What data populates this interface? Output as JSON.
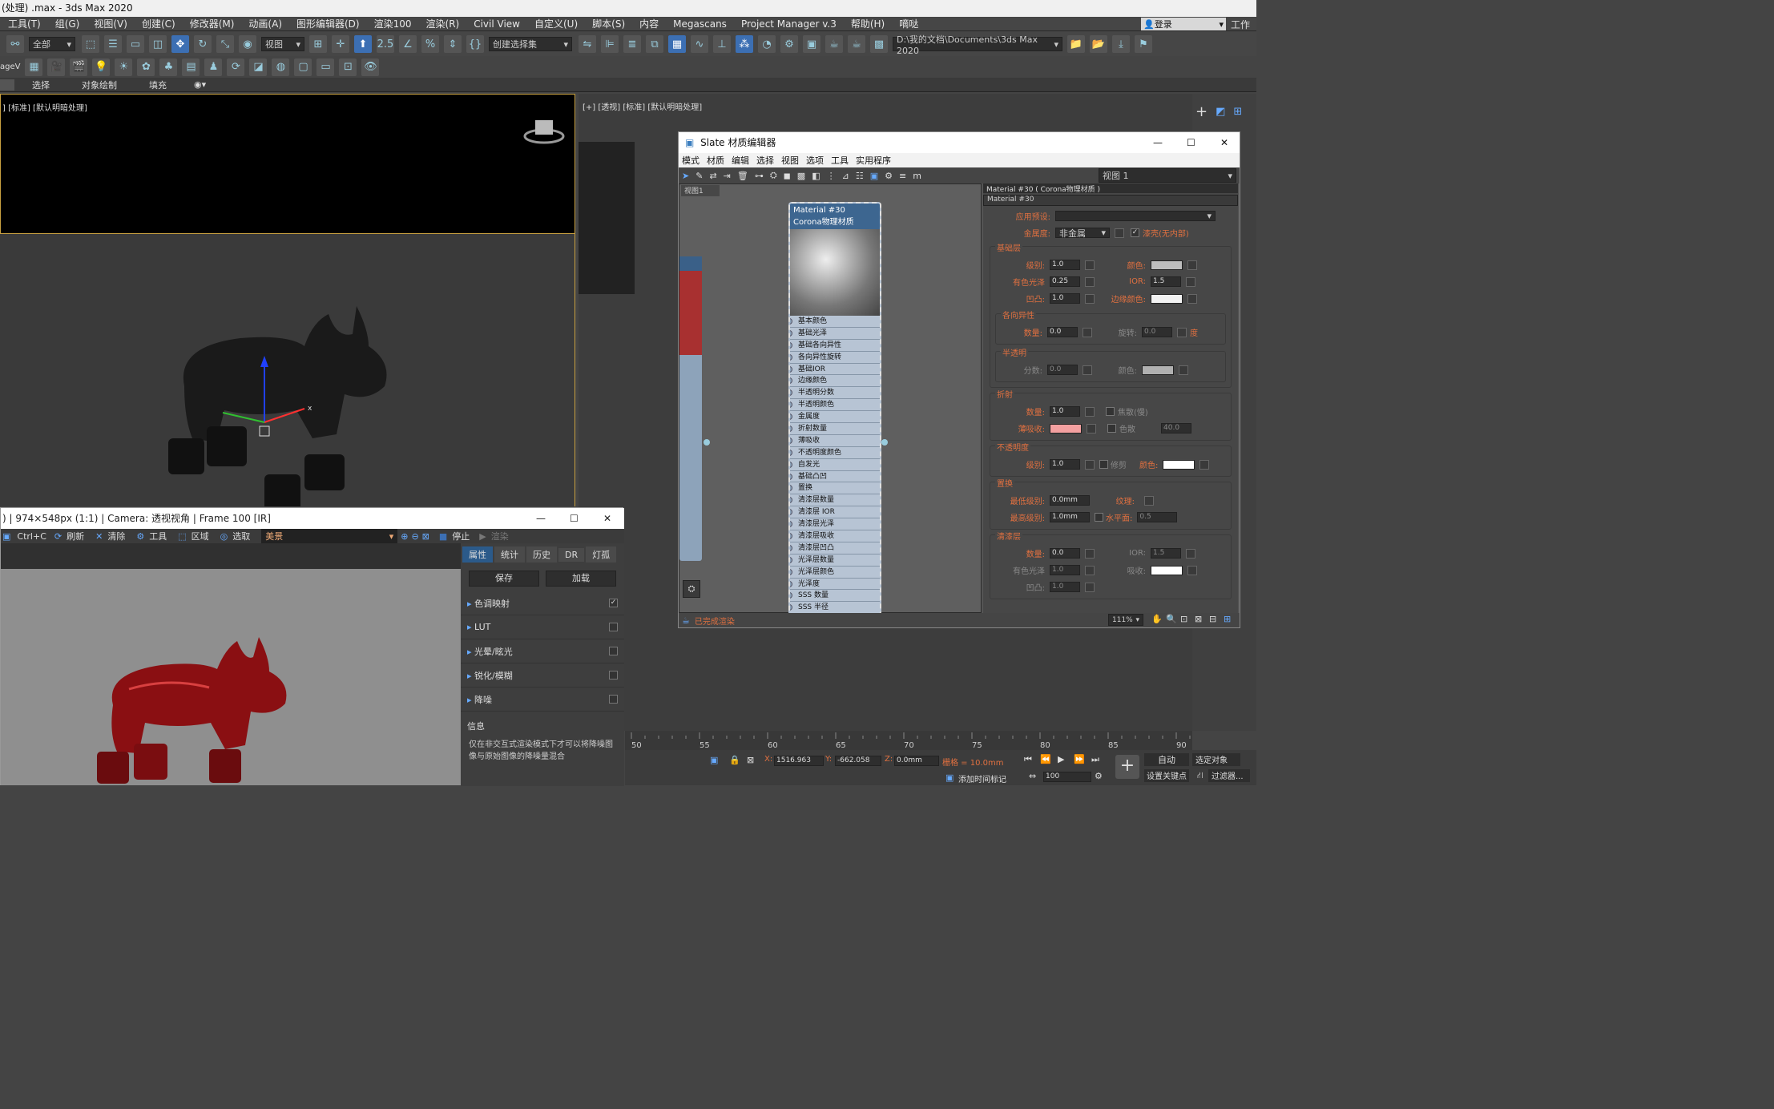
{
  "window": {
    "title": "(处理) .max - 3ds Max 2020"
  },
  "menu": [
    "工具(T)",
    "组(G)",
    "视图(V)",
    "创建(C)",
    "修改器(M)",
    "动画(A)",
    "图形编辑器(D)",
    "渲染100",
    "渲染(R)",
    "Civil View",
    "自定义(U)",
    "脚本(S)",
    "内容",
    "Megascans",
    "Project Manager v.3",
    "帮助(H)",
    "嘀哒"
  ],
  "login": "登录",
  "workspace": "工作区",
  "toolbar": {
    "filter": "全部",
    "refcoord": "视图",
    "selset": "创建选择集",
    "path": "D:\\我的文档\\Documents\\3ds Max 2020"
  },
  "toolbar2": {
    "left": "ageV"
  },
  "ribbon": {
    "items": [
      "选择",
      "对象绘制",
      "填充"
    ]
  },
  "viewports": {
    "top_label": "] [标准] [默认明暗处理]",
    "right_label": "[+] [透视] [标准] [默认明暗处理]"
  },
  "framebuffer": {
    "title": ") | 974×548px (1:1) | Camera: 透视视角 | Frame 100 [IR]",
    "tools": [
      "Ctrl+C",
      "刷新",
      "清除",
      "工具",
      "区域",
      "选取"
    ],
    "preset": "美景",
    "stop": "停止",
    "render": "渲染",
    "tabs": [
      "属性",
      "统计",
      "历史",
      "DR",
      "灯孤"
    ],
    "save": "保存",
    "load": "加载",
    "sections": [
      {
        "label": "色调映射",
        "checked": true
      },
      {
        "label": "LUT",
        "checked": false
      },
      {
        "label": "光晕/眩光",
        "checked": false
      },
      {
        "label": "锐化/模糊",
        "checked": false
      },
      {
        "label": "降噪",
        "checked": false
      }
    ],
    "info_title": "信息",
    "info_text": "仅在非交互式渲染模式下才可以将降噪图像与原始图像的降噪量混合"
  },
  "slate": {
    "title": "Slate 材质编辑器",
    "menu": [
      "模式",
      "材质",
      "编辑",
      "选择",
      "视图",
      "选项",
      "工具",
      "实用程序"
    ],
    "view_dd": "视图 1",
    "view_tab": "视图1",
    "node_title": "Material #30",
    "node_sub": "Corona物理材质",
    "slots": [
      "基本颜色",
      "基础光泽",
      "基础各向异性",
      "各向异性旋转",
      "基础IOR",
      "边缘颜色",
      "半透明分数",
      "半透明颜色",
      "金属度",
      "折射数量",
      "薄吸收",
      "不透明度颜色",
      "自发光",
      "基础凸凹",
      "置换",
      "清漆层数量",
      "清漆层 IOR",
      "清漆层光泽",
      "清漆层吸收",
      "清漆层凹凸",
      "光泽层数量",
      "光泽层颜色",
      "光泽度",
      "SSS 数量",
      "SSS 半径"
    ],
    "prop_header": "Material #30 ( Corona物理材质 )",
    "prop_name": "Material #30",
    "apply_preset": "应用预设:",
    "metal_label": "金属度:",
    "metal_val": "非金属",
    "clearcoat_label": "漆壳(无内部)",
    "base": {
      "title": "基础层",
      "level_lbl": "级别:",
      "level": "1.0",
      "color_lbl": "颜色:",
      "gloss_lbl": "有色光泽",
      "gloss": "0.25",
      "ior_lbl": "IOR:",
      "ior": "1.5",
      "bump_lbl": "凹凸:",
      "bump": "1.0",
      "edge_lbl": "边缘颜色:"
    },
    "aniso": {
      "title": "各向异性",
      "amount_lbl": "数量:",
      "amount": "0.0",
      "rot_lbl": "旋转:",
      "rot": "0.0",
      "unit": "度"
    },
    "trans": {
      "title": "半透明",
      "frac_lbl": "分数:",
      "frac": "0.0",
      "color_lbl": "颜色:"
    },
    "refr": {
      "title": "折射",
      "amount_lbl": "数量:",
      "amount": "1.0",
      "caustic": "焦散(慢)",
      "thin_lbl": "薄吸收:",
      "disp": "色散",
      "disp_val": "40.0"
    },
    "opac": {
      "title": "不透明度",
      "level_lbl": "级别:",
      "level": "1.0",
      "clip": "修剪",
      "color_lbl": "颜色:"
    },
    "displ": {
      "title": "置换",
      "min_lbl": "最低级别:",
      "min": "0.0mm",
      "tex_lbl": "纹理:",
      "max_lbl": "最高级别:",
      "max": "1.0mm",
      "water_lbl": "水平面:",
      "water": "0.5"
    },
    "coat": {
      "title": "清漆层",
      "amount_lbl": "数量:",
      "amount": "0.0",
      "ior_lbl": "IOR:",
      "ior": "1.5",
      "gloss_lbl": "有色光泽",
      "gloss": "1.0",
      "absorb_lbl": "吸收:",
      "bump_lbl": "凹凸:",
      "bump": "1.0"
    },
    "status": "已完成渲染",
    "zoom": "111%"
  },
  "timeline": {
    "ticks": [
      "50",
      "55",
      "60",
      "65",
      "70",
      "75",
      "80",
      "85",
      "90"
    ]
  },
  "status": {
    "x": "1516.963",
    "y": "-662.058",
    "z": "0.0mm",
    "grid": "栅格 = 10.0mm",
    "addtag": "添加时间标记",
    "auto": "自动",
    "setkey": "设置关键点",
    "selobj": "选定对象",
    "filter": "过滤器...",
    "frame": "100"
  },
  "colors": {
    "accent": "#3c6fb3",
    "orange": "#e07040",
    "thin_absorb": "#f4a0a0"
  }
}
